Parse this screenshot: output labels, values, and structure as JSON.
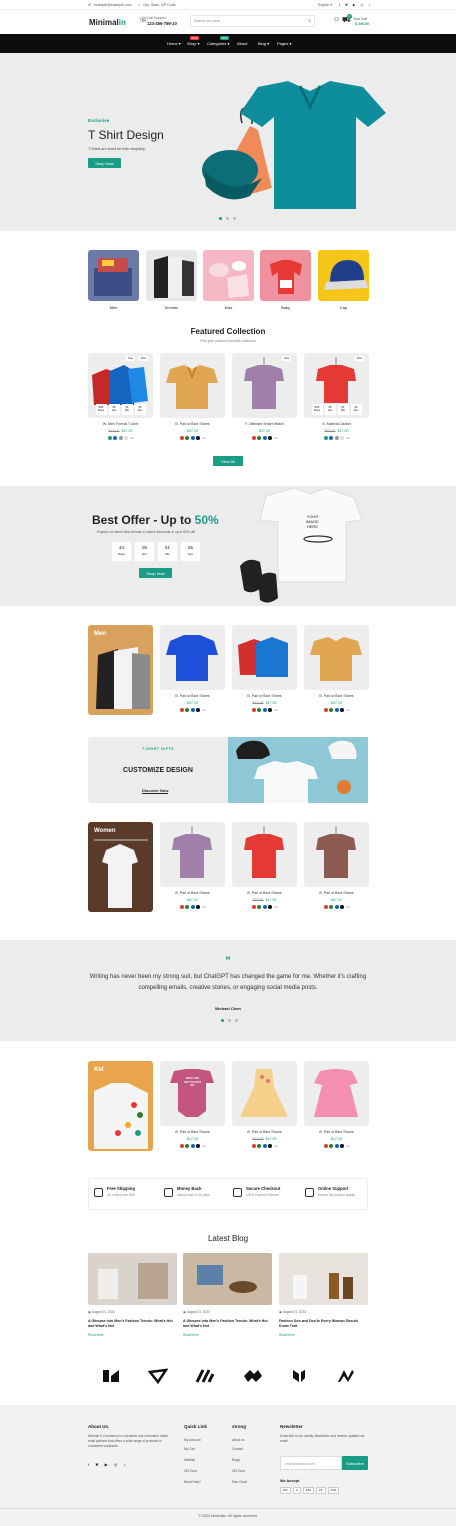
{
  "topbar": {
    "email": "example@example.com",
    "address": "City, State, ZIP Code",
    "language": "English"
  },
  "header": {
    "logo_main": "Minimal",
    "logo_accent": "in",
    "call_label": "Call Support",
    "call_number": "123-456-789-10",
    "search_placeholder": "Search our store",
    "cart_label": "Your Cart",
    "cart_total": "$ 300.00",
    "cart_count": "0"
  },
  "nav": {
    "items": [
      {
        "label": "Home",
        "arrow": "▾"
      },
      {
        "label": "Shop",
        "arrow": "▾",
        "badge": "SALE"
      },
      {
        "label": "Categories",
        "arrow": "▾",
        "badge": "NEW"
      },
      {
        "label": "About"
      },
      {
        "label": "Blog",
        "arrow": "▾"
      },
      {
        "label": "Pages",
        "arrow": "▾"
      }
    ]
  },
  "hero": {
    "eyebrow": "Exclusive",
    "title": "T Shirt Design",
    "subtitle": "T-Shirts are loved for their simplicity.",
    "button": "Shop Now"
  },
  "categories": [
    "Men",
    "Women",
    "Kids",
    "Baby",
    "Cap"
  ],
  "featured": {
    "title": "Featured Collection",
    "subtitle": "Find your product from this collection",
    "view_all": "View All",
    "products": [
      {
        "name": "W. Men Formal T-shirt",
        "old": "$73.00",
        "price": "$47.00",
        "tags": [
          "New",
          "-15%"
        ],
        "timer": [
          "580",
          "05",
          "51",
          "56"
        ]
      },
      {
        "name": "B. Pair of Blue Shoes",
        "old": "",
        "price": "$47.00",
        "tags": [],
        "timer": []
      },
      {
        "name": "F. Ultimate Smart Watch",
        "old": "",
        "price": "$47.00",
        "tags": [
          "New"
        ],
        "timer": []
      },
      {
        "name": "S. Material Jacket",
        "old": "$73.00",
        "price": "$47.00",
        "tags": [
          "-15%"
        ],
        "timer": [
          "605",
          "05",
          "51",
          "56"
        ]
      }
    ],
    "timer_labels": [
      "Days",
      "Hrs",
      "Min",
      "Sec"
    ],
    "swatch_more": "+3"
  },
  "offer": {
    "title": "Best Offer - Up to ",
    "percent": "50%",
    "subtitle": "Explore our latest New Arrivals & unlock discounts of up to 50% off!",
    "timer": [
      {
        "v": "44",
        "l": "Days"
      },
      {
        "v": "05",
        "l": "Hrs"
      },
      {
        "v": "51",
        "l": "Min"
      },
      {
        "v": "56",
        "l": "Sec"
      }
    ],
    "button": "Shop Now",
    "shirt_text": [
      "YOUR",
      "IMAGE",
      "HERE"
    ]
  },
  "men": {
    "label": "Men",
    "products": [
      {
        "name": "B. Pair of Blue Shoes",
        "old": "",
        "price": "$47.00"
      },
      {
        "name": "B. Pair of Blue Shoes",
        "old": "$73.00",
        "price": "$47.00"
      },
      {
        "name": "B. Pair of Blue Shoes",
        "old": "",
        "price": "$47.00"
      }
    ]
  },
  "customize": {
    "eyebrow": "T-SHIRT GIFTS",
    "title": "CUSTOMIZE DESIGN",
    "link": "Discover Now"
  },
  "women": {
    "label": "Women",
    "products": [
      {
        "name": "B. Pair of Blue Shoes",
        "old": "",
        "price": "$47.00"
      },
      {
        "name": "B. Pair of Blue Shoes",
        "old": "$73.00",
        "price": "$47.00"
      },
      {
        "name": "B. Pair of Blue Shoes",
        "old": "",
        "price": "$47.00"
      }
    ]
  },
  "testimonial": {
    "quote": "Writing has never been my strong suit, but ChatGPT has changed the game for me. Whether it's crafting compelling emails, creative stories, or engaging social media posts.",
    "author": "Michael Chen"
  },
  "kid": {
    "label": "Kid",
    "products": [
      {
        "name": "B. Pair of Blue Shoes",
        "old": "",
        "price": "$47.00"
      },
      {
        "name": "B. Pair of Blue Shoes",
        "old": "$73.00",
        "price": "$47.00"
      },
      {
        "name": "B. Pair of Blue Shoes",
        "old": "",
        "price": "$47.00"
      }
    ],
    "onesie_text": [
      "BUSY DO",
      "NOT TOUCH",
      "MY"
    ]
  },
  "features": [
    {
      "title": "Free Shipping",
      "sub": "On orders over $99.",
      "icon": "truck-icon"
    },
    {
      "title": "Money Back",
      "sub": "Money back in 15 days.",
      "icon": "money-icon"
    },
    {
      "title": "Secure Checkout",
      "sub": "100% Payment Secure.",
      "icon": "secure-icon"
    },
    {
      "title": "Online Support",
      "sub": "Ensure the product quality.",
      "icon": "headset-icon"
    }
  ],
  "blog": {
    "title": "Latest Blog",
    "posts": [
      {
        "date": "August 01, 2024",
        "title": "A Glimpse into Men's Fashion Trends: What's Hot and What's Not",
        "more": "Read More"
      },
      {
        "date": "August 01, 2024",
        "title": "A Glimpse into Men's Fashion Trends: What's Hot and What's Not",
        "more": "Read More"
      },
      {
        "date": "August 01, 2024",
        "title": "Fashion Dos and Don'ts Every Woman Should Know That",
        "more": "Read More"
      }
    ]
  },
  "footer": {
    "about_title": "About Us.",
    "about_text": "Minimal E-Commerce is a dynamic and innovative online retail platform that offers a wide range of products to customers worldwide.",
    "quick_title": "Quick Link",
    "quick_links": [
      "My Account",
      "My Cart",
      "Wishlist",
      "Gift Card",
      "Need Help?"
    ],
    "strong_title": "strong",
    "strong_links": [
      "About us",
      "Contact",
      "Blogs",
      "Gift Card",
      "Size Chart"
    ],
    "news_title": "Newsletter",
    "news_text": "Subscribe to our weekly Newsletter and receive updates via email.",
    "email_placeholder": "email@example.com",
    "subscribe": "Subscribe",
    "accept": "We Accept",
    "payments": [
      "PAY",
      "G",
      "ETH",
      "PP",
      "VISA"
    ],
    "copyright": "© 2024 Minimalin. All rights reserved."
  }
}
